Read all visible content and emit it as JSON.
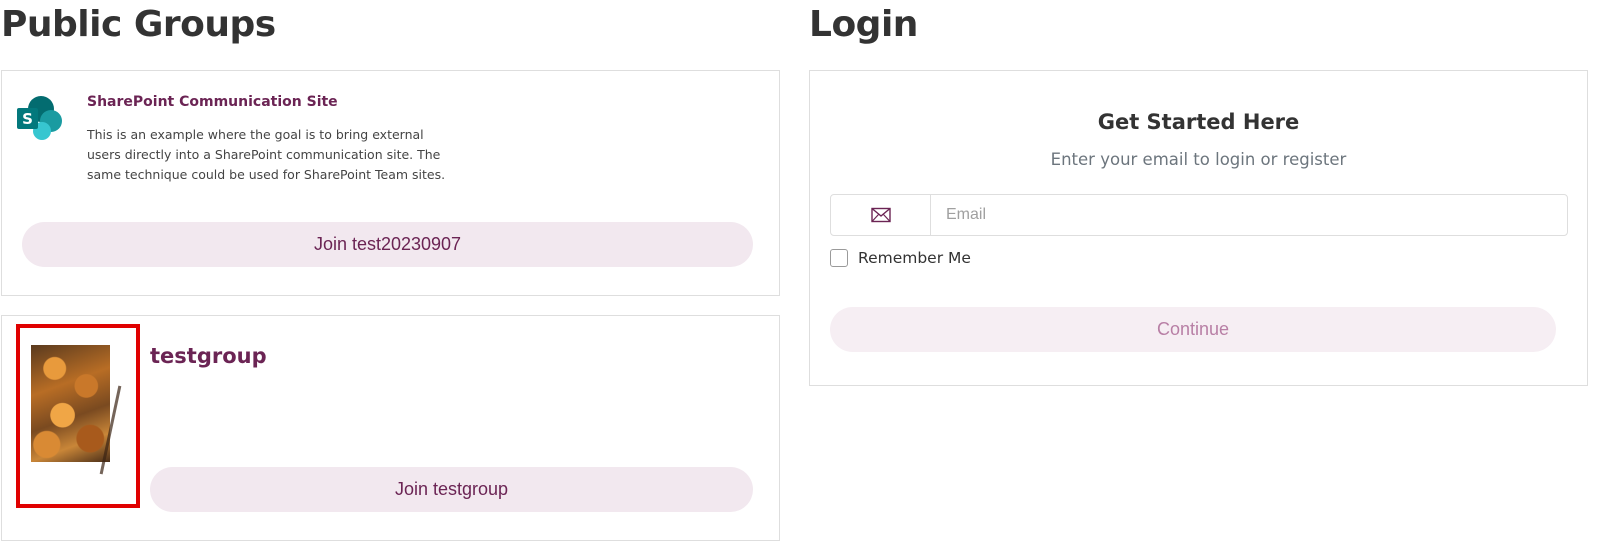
{
  "public_groups": {
    "heading": "Public Groups",
    "groups": [
      {
        "icon": "sharepoint-icon",
        "title": "SharePoint Communication Site",
        "description": "This is an example where the goal is to bring external users directly into a SharePoint communication site. The same technique could be used for SharePoint Team sites.",
        "join_label": "Join test20230907"
      },
      {
        "icon": "autumn-leaves-thumbnail",
        "title": "testgroup",
        "join_label": "Join testgroup"
      }
    ]
  },
  "login": {
    "heading": "Login",
    "title": "Get Started Here",
    "subtitle": "Enter your email to login or register",
    "email_icon": "envelope-icon",
    "email_placeholder": "Email",
    "email_value": "",
    "remember_label": "Remember Me",
    "remember_checked": false,
    "continue_label": "Continue"
  },
  "colors": {
    "brand": "#6b2454",
    "pill_bg": "#f2e8ef",
    "highlight": "#e00000",
    "sharepoint_teal": "#038387"
  }
}
